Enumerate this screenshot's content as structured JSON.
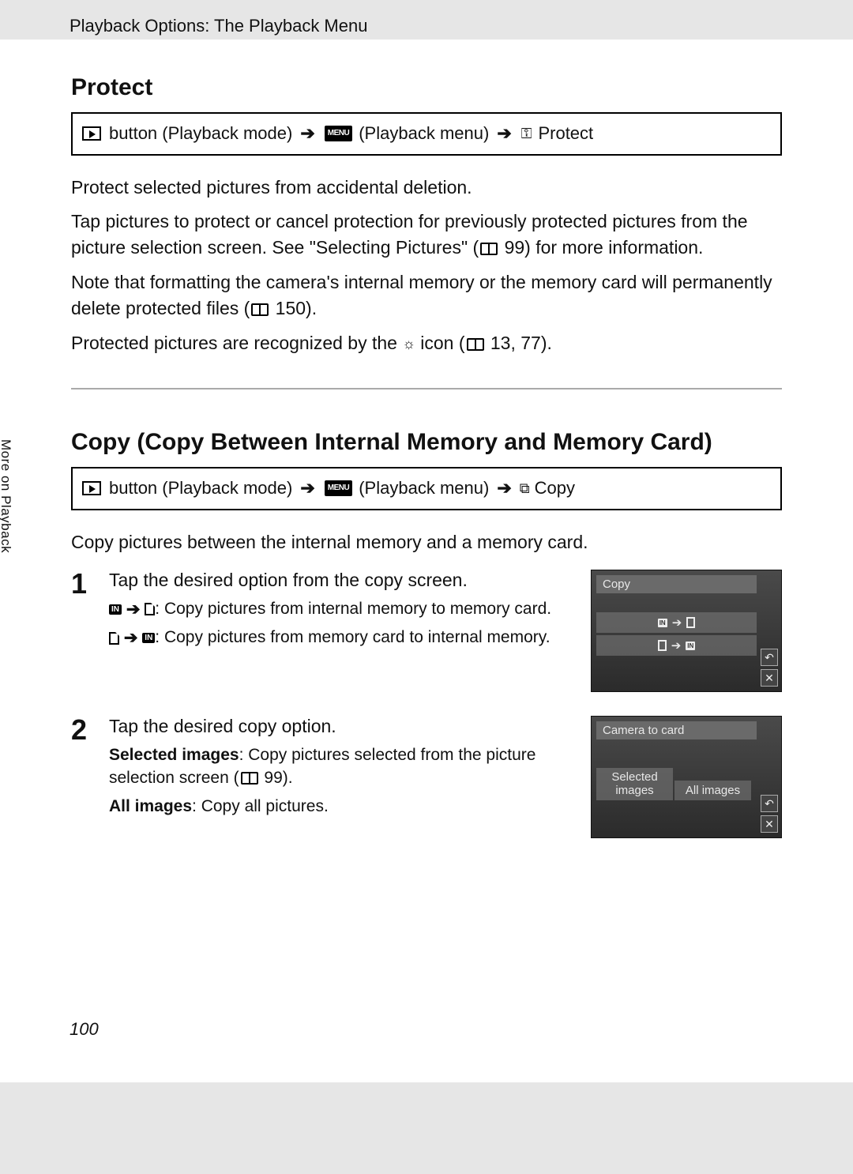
{
  "header": "Playback Options: The Playback Menu",
  "page_number": "100",
  "sidebar_tab": "More on Playback",
  "protect": {
    "title": "Protect",
    "nav": {
      "btn_label": "button (Playback mode)",
      "menu_label": "(Playback menu)",
      "dest": "Protect"
    },
    "p1": "Protect selected pictures from accidental deletion.",
    "p2a": "Tap pictures to protect or cancel protection for previously protected pictures from the picture selection screen. See \"Selecting Pictures\" (",
    "p2_ref": " 99) for more information.",
    "p3a": "Note that formatting the camera's internal memory or the memory card will permanently delete protected files (",
    "p3_ref": " 150).",
    "p4a": "Protected pictures are recognized by the ",
    "p4b": " icon (",
    "p4_ref": " 13, 77)."
  },
  "copy": {
    "title": "Copy (Copy Between Internal Memory and Memory Card)",
    "nav": {
      "btn_label": "button (Playback mode)",
      "menu_label": "(Playback menu)",
      "dest": "Copy"
    },
    "intro": "Copy pictures between the internal memory and a memory card.",
    "step1": {
      "num": "1",
      "lead": "Tap the desired option from the copy screen.",
      "opt1": ": Copy pictures from internal memory to memory card.",
      "opt2": ": Copy pictures from memory card to internal memory.",
      "shot_title": "Copy"
    },
    "step2": {
      "num": "2",
      "lead": "Tap the desired copy option.",
      "opt1_bold": "Selected images",
      "opt1_rest_a": ": Copy pictures selected from the picture selection screen (",
      "opt1_ref": " 99).",
      "opt2_bold": "All images",
      "opt2_rest": ": Copy all pictures.",
      "shot_title": "Camera to card",
      "shot_btn1": "Selected images",
      "shot_btn2": "All images"
    }
  }
}
